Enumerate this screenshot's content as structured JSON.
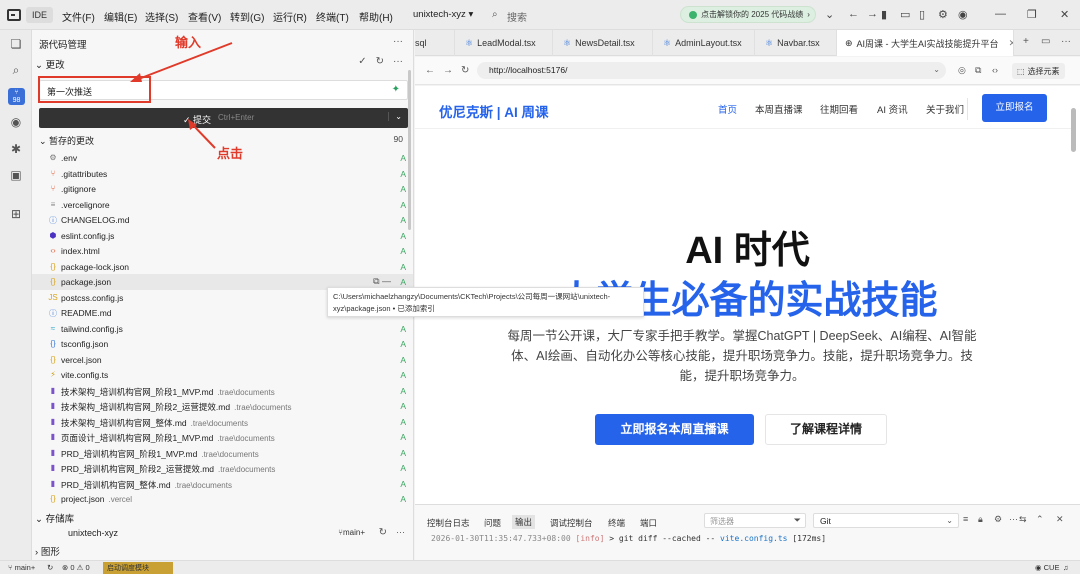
{
  "titlebar": {
    "ide_label": "IDE",
    "menu": [
      "文件(F)",
      "编辑(E)",
      "选择(S)",
      "查看(V)",
      "转到(G)",
      "运行(R)",
      "终端(T)",
      "帮助(H)"
    ],
    "project": "unixtech-xyz",
    "search_placeholder": "搜索",
    "promo": "点击解锁你的 2025 代码战绩"
  },
  "activity": {
    "badge": "98"
  },
  "scm": {
    "title": "源代码管理",
    "changes_label": "更改",
    "commit_message": "第一次推送",
    "commit_button": "提交",
    "commit_hint": "Ctrl+Enter",
    "staged_label": "暂存的更改",
    "staged_count": "90",
    "files": [
      {
        "name": ".env",
        "dir": "",
        "status": "A",
        "icon": "gear-icon",
        "color": "#777777"
      },
      {
        "name": ".gitattributes",
        "dir": "",
        "status": "A",
        "icon": "git-icon",
        "color": "#e0603a"
      },
      {
        "name": ".gitignore",
        "dir": "",
        "status": "A",
        "icon": "git-icon",
        "color": "#e0603a"
      },
      {
        "name": ".vercelignore",
        "dir": "",
        "status": "A",
        "icon": "file-icon",
        "color": "#888888"
      },
      {
        "name": "CHANGELOG.md",
        "dir": "",
        "status": "A",
        "icon": "info-icon",
        "color": "#3a78d8"
      },
      {
        "name": "eslint.config.js",
        "dir": "",
        "status": "A",
        "icon": "eslint-icon",
        "color": "#4b32c3"
      },
      {
        "name": "index.html",
        "dir": "",
        "status": "A",
        "icon": "html-icon",
        "color": "#e0603a"
      },
      {
        "name": "package-lock.json",
        "dir": "",
        "status": "A",
        "icon": "json-icon",
        "color": "#d9a520"
      },
      {
        "name": "package.json",
        "dir": "",
        "status": "A",
        "icon": "json-icon",
        "color": "#d9a520"
      },
      {
        "name": "postcss.config.js",
        "dir": "",
        "status": "A",
        "icon": "js-icon",
        "color": "#d9a520"
      },
      {
        "name": "README.md",
        "dir": "",
        "status": "A",
        "icon": "info-icon",
        "color": "#3a78d8"
      },
      {
        "name": "tailwind.config.js",
        "dir": "",
        "status": "A",
        "icon": "tailwind-icon",
        "color": "#2aa3c8"
      },
      {
        "name": "tsconfig.json",
        "dir": "",
        "status": "A",
        "icon": "ts-icon",
        "color": "#3a78d8"
      },
      {
        "name": "vercel.json",
        "dir": "",
        "status": "A",
        "icon": "json-icon",
        "color": "#d9a520"
      },
      {
        "name": "vite.config.ts",
        "dir": "",
        "status": "A",
        "icon": "vite-icon",
        "color": "#c9a020"
      },
      {
        "name": "技术架构_培训机构官网_阶段1_MVP.md",
        "dir": ".trae\\documents",
        "status": "A",
        "icon": "markdown-icon",
        "color": "#7b52c9"
      },
      {
        "name": "技术架构_培训机构官网_阶段2_运营提效.md",
        "dir": ".trae\\documents",
        "status": "A",
        "icon": "markdown-icon",
        "color": "#7b52c9"
      },
      {
        "name": "技术架构_培训机构官网_整体.md",
        "dir": ".trae\\documents",
        "status": "A",
        "icon": "markdown-icon",
        "color": "#7b52c9"
      },
      {
        "name": "页面设计_培训机构官网_阶段1_MVP.md",
        "dir": ".trae\\documents",
        "status": "A",
        "icon": "markdown-icon",
        "color": "#7b52c9"
      },
      {
        "name": "PRD_培训机构官网_阶段1_MVP.md",
        "dir": ".trae\\documents",
        "status": "A",
        "icon": "markdown-icon",
        "color": "#7b52c9"
      },
      {
        "name": "PRD_培训机构官网_阶段2_运营提效.md",
        "dir": ".trae\\documents",
        "status": "A",
        "icon": "markdown-icon",
        "color": "#7b52c9"
      },
      {
        "name": "PRD_培训机构官网_整体.md",
        "dir": ".trae\\documents",
        "status": "A",
        "icon": "markdown-icon",
        "color": "#7b52c9"
      },
      {
        "name": "project.json",
        "dir": ".vercel",
        "status": "A",
        "icon": "json-icon",
        "color": "#d9a520"
      }
    ],
    "tooltip": "C:\\Users\\michaelzhangzy\\Documents\\CKTech\\Projects\\公司每周一课网站\\unixtech-xyz\\package.json • 已添加索引",
    "repos_label": "存储库",
    "repo_name": "unixtech-xyz",
    "repo_branch": "main+",
    "graph_label": "图形"
  },
  "annotations": {
    "input": "输入",
    "click": "点击"
  },
  "editor_tabs": [
    "sql",
    "LeadModal.tsx",
    "NewsDetail.tsx",
    "AdminLayout.tsx",
    "Navbar.tsx",
    "AI周课 - 大学生AI实战技能提升平台"
  ],
  "browser": {
    "url": "http://localhost:5176/",
    "select_element": "选择元素"
  },
  "site": {
    "brand": "优尼克斯 | AI 周课",
    "nav": [
      "首页",
      "本周直播课",
      "往期回看",
      "AI 资讯",
      "关于我们"
    ],
    "cta": "立即报名",
    "hero_line1": "AI 时代",
    "hero_line2": "大学生必备的实战技能",
    "description": "每周一节公开课，大厂专家手把手教学。掌握ChatGPT | DeepSeek、AI编程、AI智能体、AI绘画、自动化办公等核心技能，提升职场竞争力。技能，提升职场竞争力。技能，提升职场竞争力。",
    "btn_primary": "立即报名本周直播课",
    "btn_secondary": "了解课程详情",
    "brand_color": "#2563eb"
  },
  "panel": {
    "tabs": [
      "控制台日志",
      "问题",
      "输出",
      "调试控制台",
      "终端",
      "端口"
    ],
    "active_tab": "输出",
    "filter_placeholder": "筛选器",
    "channel": "Git",
    "log_time": "2026-01-30T11:35:47.733+08:00",
    "log_level": "[info]",
    "log_cmd": "> git diff --cached --",
    "log_file": "vite.config.ts",
    "log_ms": "[172ms]"
  },
  "status": {
    "branch": "main+",
    "errors": "0",
    "warnings": "0",
    "label": "启动调度模块",
    "right": "CUE"
  }
}
